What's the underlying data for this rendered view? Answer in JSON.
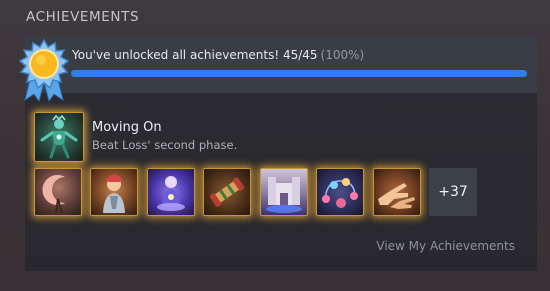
{
  "section": {
    "heading": "ACHIEVEMENTS"
  },
  "summary": {
    "message": "You've unlocked all achievements! 45/45",
    "percent_label": "(100%)",
    "progress": 1.0,
    "badge_icon": "sun-ribbon-badge-icon"
  },
  "featured": {
    "icon": "moving-on-achievement-icon",
    "title": "Moving On",
    "description": "Beat Loss' second phase."
  },
  "achievement_icons": [
    "crescent-moon-achievement-icon",
    "character-portrait-achievement-icon",
    "purple-figure-achievement-icon",
    "scroll-roll-achievement-icon",
    "castle-achievement-icon",
    "orbit-orbs-achievement-icon",
    "pointing-hands-achievement-icon"
  ],
  "more_count_label": "+37",
  "view_link": "View My Achievements",
  "colors": {
    "progress_fill": "#2f7fe8",
    "glow": "#ffb93c"
  }
}
